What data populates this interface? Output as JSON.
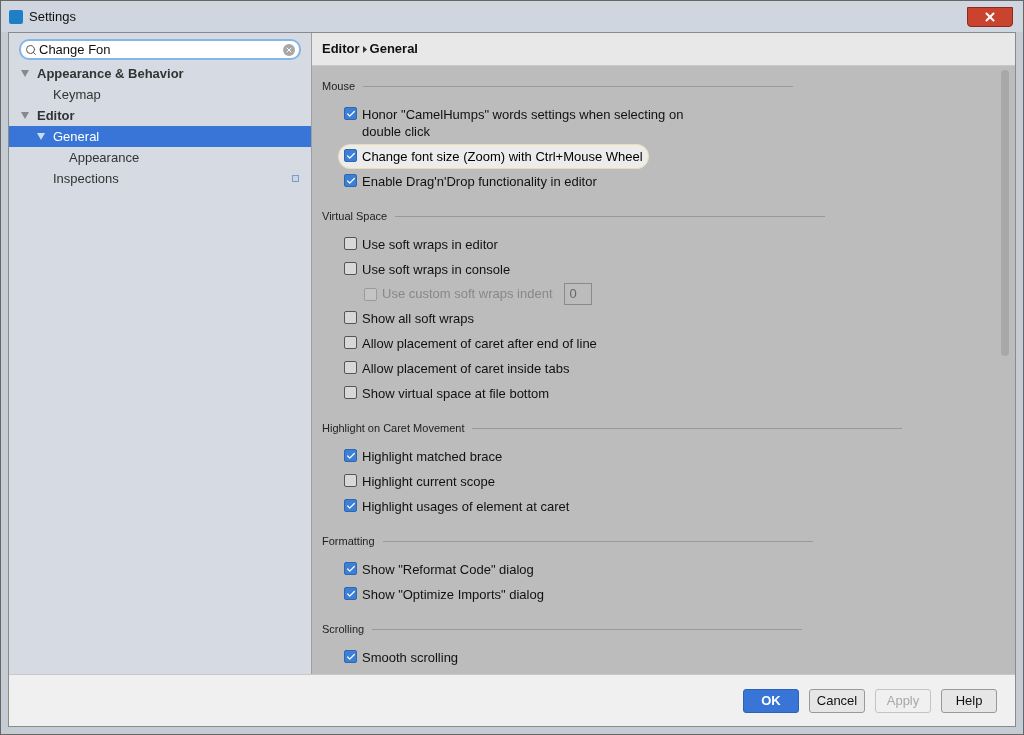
{
  "window": {
    "title": "Settings"
  },
  "search": {
    "value": "Change Fon"
  },
  "tree": [
    {
      "label": "Appearance & Behavior",
      "bold": true,
      "expanded": true,
      "selected": false,
      "children": [
        {
          "label": "Keymap",
          "selected": false
        }
      ]
    },
    {
      "label": "Editor",
      "bold": true,
      "expanded": true,
      "selected": false,
      "children": [
        {
          "label": "General",
          "expanded": true,
          "selected": true,
          "children": [
            {
              "label": "Appearance",
              "selected": false
            }
          ]
        },
        {
          "label": "Inspections",
          "selected": false,
          "has_badge": true
        }
      ]
    }
  ],
  "breadcrumb": [
    "Editor",
    "General"
  ],
  "settings": [
    {
      "kind": "section",
      "label": "Mouse"
    },
    {
      "kind": "checkbox",
      "label": "Honor \"CamelHumps\" words settings when selecting on double click",
      "checked": true,
      "highlighted": false
    },
    {
      "kind": "checkbox",
      "label": "Change font size (Zoom) with Ctrl+Mouse Wheel",
      "checked": true,
      "highlighted": true
    },
    {
      "kind": "checkbox",
      "label": "Enable Drag'n'Drop functionality in editor",
      "checked": true,
      "highlighted": false
    },
    {
      "kind": "section",
      "label": "Virtual Space"
    },
    {
      "kind": "checkbox",
      "label": "Use soft wraps in editor",
      "checked": false,
      "highlighted": false
    },
    {
      "kind": "checkbox",
      "label": "Use soft wraps in console",
      "checked": false,
      "highlighted": false,
      "children": [
        {
          "label": "Use custom soft wraps indent",
          "checked": false,
          "disabled": true,
          "value": "0"
        }
      ]
    },
    {
      "kind": "checkbox",
      "label": "Show all soft wraps",
      "checked": false,
      "highlighted": false
    },
    {
      "kind": "checkbox",
      "label": "Allow placement of caret after end of line",
      "checked": false,
      "highlighted": false
    },
    {
      "kind": "checkbox",
      "label": "Allow placement of caret inside tabs",
      "checked": false,
      "highlighted": false
    },
    {
      "kind": "checkbox",
      "label": "Show virtual space at file bottom",
      "checked": false,
      "highlighted": false
    },
    {
      "kind": "section",
      "label": "Highlight on Caret Movement"
    },
    {
      "kind": "checkbox",
      "label": "Highlight matched brace",
      "checked": true,
      "highlighted": false
    },
    {
      "kind": "checkbox",
      "label": "Highlight current scope",
      "checked": false,
      "highlighted": false
    },
    {
      "kind": "checkbox",
      "label": "Highlight usages of element at caret",
      "checked": true,
      "highlighted": false
    },
    {
      "kind": "section",
      "label": "Formatting"
    },
    {
      "kind": "checkbox",
      "label": "Show \"Reformat Code\" dialog",
      "checked": true,
      "highlighted": false
    },
    {
      "kind": "checkbox",
      "label": "Show \"Optimize Imports\" dialog",
      "checked": true,
      "highlighted": false
    },
    {
      "kind": "section",
      "label": "Scrolling"
    },
    {
      "kind": "checkbox",
      "label": "Smooth scrolling",
      "checked": true,
      "highlighted": false
    }
  ],
  "buttons": [
    {
      "label": "OK",
      "kind": "primary",
      "disabled": false
    },
    {
      "label": "Cancel",
      "kind": "normal",
      "disabled": false
    },
    {
      "label": "Apply",
      "kind": "normal",
      "disabled": true
    },
    {
      "label": "Help",
      "kind": "normal",
      "disabled": false
    }
  ]
}
